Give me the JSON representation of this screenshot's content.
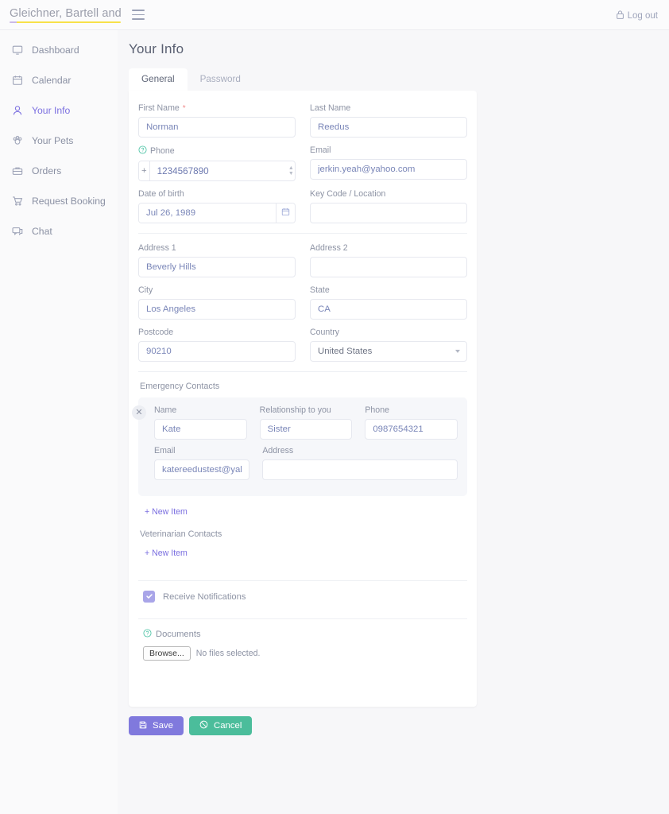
{
  "topbar": {
    "brand": "Gleichner, Bartell and M",
    "menu_icon": "hamburger-icon",
    "logout_label": "Log out",
    "logout_icon": "lock-icon",
    "accent_underline": "#f7e14a"
  },
  "sidebar": {
    "items": [
      {
        "label": "Dashboard",
        "icon": "monitor-icon",
        "active": false
      },
      {
        "label": "Calendar",
        "icon": "calendar-icon",
        "active": false
      },
      {
        "label": "Your Info",
        "icon": "user-icon",
        "active": true
      },
      {
        "label": "Your Pets",
        "icon": "paw-icon",
        "active": false
      },
      {
        "label": "Orders",
        "icon": "briefcase-icon",
        "active": false
      },
      {
        "label": "Request Booking",
        "icon": "cart-icon",
        "active": false
      },
      {
        "label": "Chat",
        "icon": "chat-icon",
        "active": false
      }
    ],
    "active_color": "#7b6fe0"
  },
  "main": {
    "page_title": "Your Info",
    "tabs": [
      {
        "label": "General",
        "active": true
      },
      {
        "label": "Password",
        "active": false
      }
    ]
  },
  "form": {
    "first_name": {
      "label": "First Name",
      "required": true,
      "value": "Norman"
    },
    "last_name": {
      "label": "Last Name",
      "required": false,
      "value": "Reedus"
    },
    "phone": {
      "label": "Phone",
      "help_icon": "question-circle-icon",
      "prefix": "+",
      "value": "1234567890",
      "spinner_icon": "stepper-icon"
    },
    "email": {
      "label": "Email",
      "value": "jerkin.yeah@yahoo.com"
    },
    "dob": {
      "label": "Date of birth",
      "value": "Jul 26, 1989",
      "picker_icon": "calendar-icon"
    },
    "key_code": {
      "label": "Key Code / Location",
      "value": ""
    },
    "address1": {
      "label": "Address 1",
      "value": "Beverly Hills"
    },
    "address2": {
      "label": "Address 2",
      "value": ""
    },
    "city": {
      "label": "City",
      "value": "Los Angeles"
    },
    "state": {
      "label": "State",
      "value": "CA"
    },
    "postcode": {
      "label": "Postcode",
      "value": "90210"
    },
    "country": {
      "label": "Country",
      "value": "United States",
      "options": [
        "United States"
      ]
    }
  },
  "emergency": {
    "section_title": "Emergency Contacts",
    "remove_icon": "close-icon",
    "fields": {
      "name_label": "Name",
      "relationship_label": "Relationship to you",
      "phone_label": "Phone",
      "email_label": "Email",
      "address_label": "Address"
    },
    "contact": {
      "name": "Kate",
      "relationship": "Sister",
      "phone": "0987654321",
      "email": "katereedustest@yahoo.com",
      "address": ""
    },
    "new_item_label": "+ New Item"
  },
  "veterinarian": {
    "section_title": "Veterinarian Contacts",
    "new_item_label": "+ New Item"
  },
  "notifications": {
    "label": "Receive Notifications",
    "checked": true,
    "check_icon": "checkmark-icon",
    "color": "#a9a5e8"
  },
  "documents": {
    "label": "Documents",
    "help_icon": "question-circle-icon",
    "browse_label": "Browse...",
    "file_status": "No files selected."
  },
  "footer": {
    "save_label": "Save",
    "save_icon": "floppy-disk-icon",
    "save_color": "#8079dd",
    "cancel_label": "Cancel",
    "cancel_icon": "ban-icon",
    "cancel_color": "#4bbd9b"
  }
}
